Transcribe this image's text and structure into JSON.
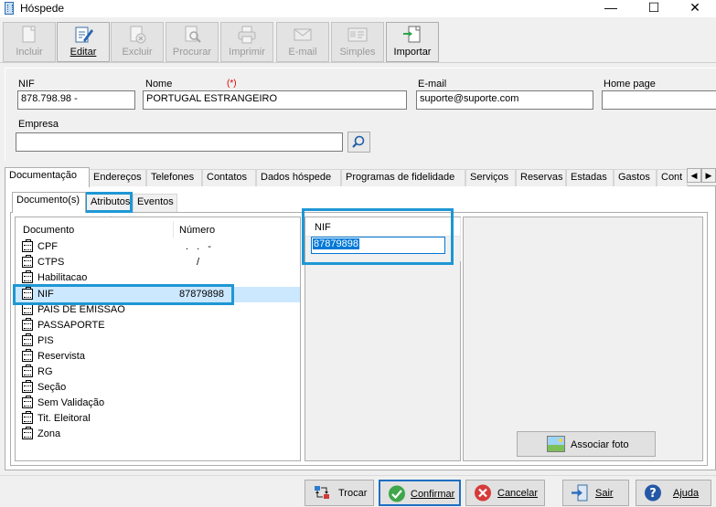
{
  "window": {
    "title": "Hóspede",
    "minimize": "—",
    "maximize": "☐",
    "close": "✕"
  },
  "toolbar": {
    "incluir": "Incluir",
    "editar": "Editar",
    "excluir": "Excluir",
    "procurar": "Procurar",
    "imprimir": "Imprimir",
    "email": "E-mail",
    "simples": "Simples",
    "importar": "Importar"
  },
  "form": {
    "nif_label": "NIF",
    "nif_value": "878.798.98 -",
    "nome_label": "Nome",
    "nome_required": "(*)",
    "nome_value": "PORTUGAL ESTRANGEIRO",
    "email_label": "E-mail",
    "email_value": "suporte@suporte.com",
    "homepage_label": "Home page",
    "homepage_value": "",
    "empresa_label": "Empresa",
    "empresa_value": ""
  },
  "main_tabs": [
    {
      "label": "Documentação"
    },
    {
      "label": "Endereços"
    },
    {
      "label": "Telefones"
    },
    {
      "label": "Contatos"
    },
    {
      "label": "Dados hóspede"
    },
    {
      "label": "Programas de fidelidade"
    },
    {
      "label": "Serviços"
    },
    {
      "label": "Reservas"
    },
    {
      "label": "Estadas"
    },
    {
      "label": "Gastos"
    },
    {
      "label": "Cont"
    }
  ],
  "tab_scroll": {
    "left": "◀",
    "right": "▶"
  },
  "inner_tabs": [
    {
      "label": "Documento(s)"
    },
    {
      "label": "Atributos"
    },
    {
      "label": "Eventos"
    }
  ],
  "doc_list": {
    "col_documento": "Documento",
    "col_numero": "Número",
    "rows": [
      {
        "name": "CPF",
        "number": ". . -"
      },
      {
        "name": "CTPS",
        "number": "/"
      },
      {
        "name": "Habilitacao",
        "number": ""
      },
      {
        "name": "NIF",
        "number": "87879898"
      },
      {
        "name": "PAIS DE EMISSAO",
        "number": ""
      },
      {
        "name": "PASSAPORTE",
        "number": ""
      },
      {
        "name": "PIS",
        "number": ""
      },
      {
        "name": "Reservista",
        "number": ""
      },
      {
        "name": "RG",
        "number": ""
      },
      {
        "name": "Seção",
        "number": ""
      },
      {
        "name": "Sem Validação",
        "number": ""
      },
      {
        "name": "Tit. Eleitoral",
        "number": ""
      },
      {
        "name": "Zona",
        "number": ""
      }
    ]
  },
  "attribute": {
    "header": "NIF",
    "value": "87879898"
  },
  "photo": {
    "button_label": "Associar foto"
  },
  "footer": {
    "trocar": "Trocar",
    "confirmar": "Confirmar",
    "cancelar": "Cancelar",
    "sair": "Sair",
    "ajuda": "Ajuda"
  },
  "colors": {
    "highlight": "#1e97d4",
    "selection": "#cce8ff",
    "required": "#e00000"
  }
}
